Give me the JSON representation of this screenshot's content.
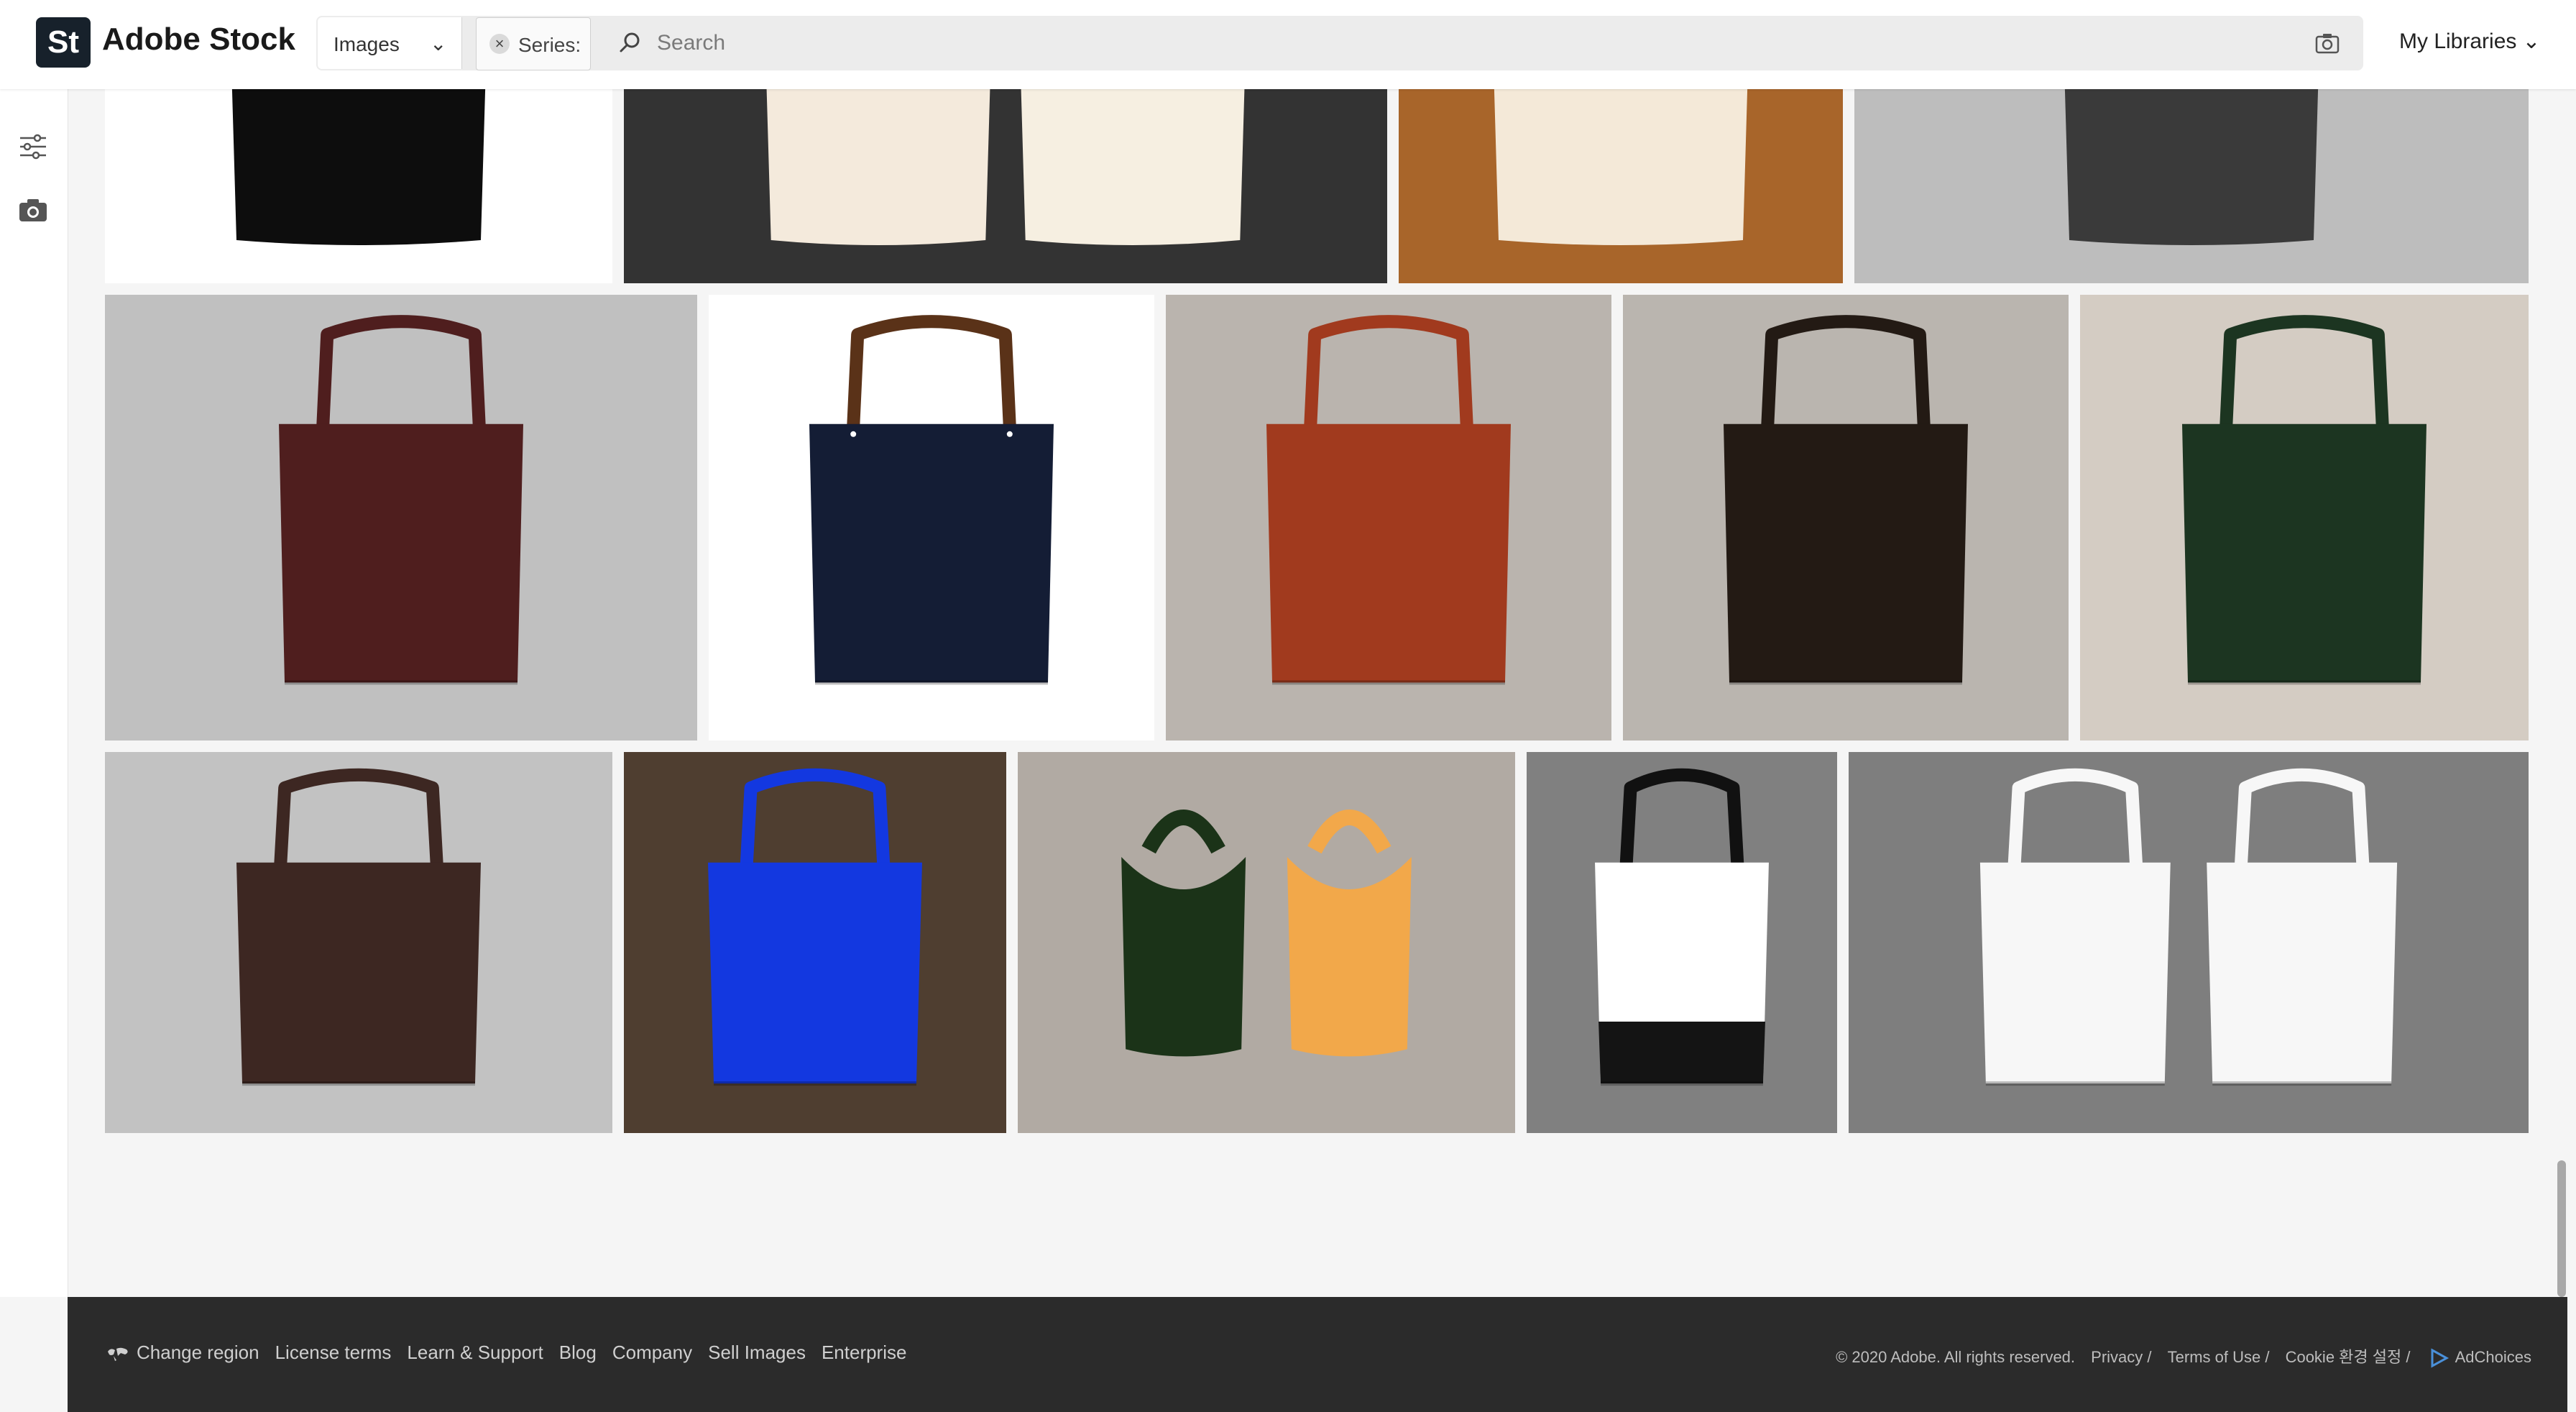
{
  "header": {
    "logo_badge": "St",
    "logo_text": "Adobe Stock",
    "asset_type": "Images",
    "series_chip": "Series:",
    "search_placeholder": "Search",
    "my_libraries": "My Libraries"
  },
  "rail": {
    "icons": [
      "filter-sliders-icon",
      "camera-icon"
    ]
  },
  "grid": {
    "tiles": [
      {
        "row": 1,
        "background": "#ffffff",
        "bags": [
          {
            "color": "#0d0d0d",
            "kind": "tote-bottom"
          }
        ]
      },
      {
        "row": 1,
        "background": "#333333",
        "bags": [
          {
            "color": "#f4eadc",
            "kind": "tote-bottom"
          },
          {
            "color": "#f6efe1",
            "kind": "tote-bottom"
          }
        ]
      },
      {
        "row": 1,
        "background": "#a8652a",
        "bags": [
          {
            "color": "#f4e9d8",
            "kind": "tote-bottom"
          }
        ]
      },
      {
        "row": 1,
        "background": "#bdbdbd",
        "bags": [
          {
            "color": "#3a3a3a",
            "kind": "tote-bottom"
          }
        ]
      },
      {
        "row": 2,
        "background": "#c0c0c0",
        "bags": [
          {
            "color": "#4f1e1e",
            "kind": "leather-tote"
          }
        ]
      },
      {
        "row": 2,
        "background": "#ffffff",
        "bags": [
          {
            "color": "#141d35",
            "kind": "navy-tote"
          }
        ]
      },
      {
        "row": 2,
        "background": "#bab4ae",
        "bags": [
          {
            "color": "#a13a1e",
            "kind": "tote"
          }
        ]
      },
      {
        "row": 2,
        "background": "#bab5af",
        "bags": [
          {
            "color": "#231a14",
            "kind": "tote"
          }
        ]
      },
      {
        "row": 2,
        "background": "#d4ccc3",
        "bags": [
          {
            "color": "#1c3521",
            "kind": "tote"
          }
        ]
      },
      {
        "row": 3,
        "background": "#c2c2c2",
        "bags": [
          {
            "color": "#3d2722",
            "kind": "leather-tote"
          }
        ]
      },
      {
        "row": 3,
        "background": "#4f3e30",
        "bags": [
          {
            "color": "#1338e0",
            "kind": "flat-tote"
          }
        ]
      },
      {
        "row": 3,
        "background": "#b1aaa3",
        "bags": [
          {
            "color": "#1b3318",
            "kind": "hobo"
          },
          {
            "color": "#f2a84a",
            "kind": "hobo"
          }
        ]
      },
      {
        "row": 3,
        "background": "#808080",
        "bags": [
          {
            "color": "#ffffff",
            "kind": "two-tone"
          }
        ]
      },
      {
        "row": 3,
        "background": "#7e7e7e",
        "bags": [
          {
            "color": "#f7f7f7",
            "kind": "white-tote"
          },
          {
            "color": "#f7f7f7",
            "kind": "white-tote"
          }
        ]
      }
    ]
  },
  "footer": {
    "links": [
      "Change region",
      "License terms",
      "Learn & Support",
      "Blog",
      "Company",
      "Sell Images",
      "Enterprise"
    ],
    "copyright": "© 2020 Adobe. All rights reserved.",
    "legal": [
      "Privacy /",
      "Terms of Use /",
      "Cookie 환경 설정 /"
    ],
    "adchoices": "AdChoices"
  },
  "colors": {
    "header_bg": "#ffffff",
    "logo_badge": "#17212b",
    "footer_bg": "#2b2b2b",
    "page_bg": "#f5f5f5"
  }
}
